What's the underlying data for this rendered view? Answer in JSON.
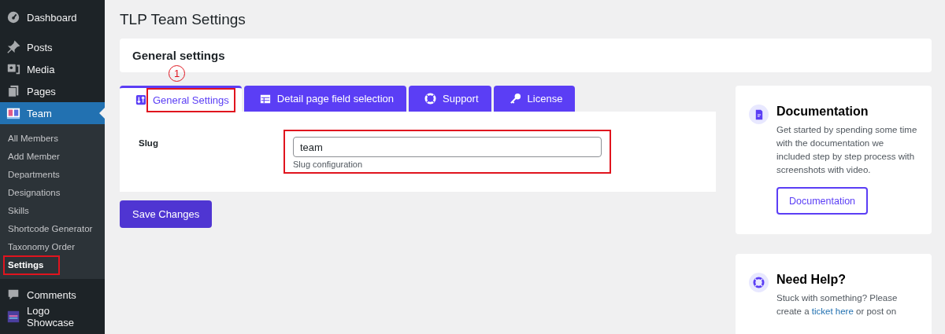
{
  "sidebar": {
    "items": [
      {
        "label": "Dashboard",
        "current": false
      },
      {
        "label": "Posts",
        "current": false
      },
      {
        "label": "Media",
        "current": false
      },
      {
        "label": "Pages",
        "current": false
      },
      {
        "label": "Team",
        "current": true,
        "children": [
          {
            "label": "All Members",
            "selected": false,
            "highlighted": false
          },
          {
            "label": "Add Member",
            "selected": false,
            "highlighted": false
          },
          {
            "label": "Departments",
            "selected": false,
            "highlighted": false
          },
          {
            "label": "Designations",
            "selected": false,
            "highlighted": false
          },
          {
            "label": "Skills",
            "selected": false,
            "highlighted": false
          },
          {
            "label": "Shortcode Generator",
            "selected": false,
            "highlighted": false
          },
          {
            "label": "Taxonomy Order",
            "selected": false,
            "highlighted": false
          },
          {
            "label": "Settings",
            "selected": true,
            "highlighted": true
          }
        ]
      },
      {
        "label": "Comments",
        "current": false
      },
      {
        "label": "Logo Showcase",
        "current": false
      }
    ]
  },
  "page_title": "TLP Team Settings",
  "header_card": {
    "title": "General settings"
  },
  "step_marker": "1",
  "tabs": [
    {
      "label": "General Settings",
      "selected": true,
      "highlighted": true
    },
    {
      "label": "Detail page field selection",
      "selected": false,
      "highlighted": false
    },
    {
      "label": "Support",
      "selected": false,
      "highlighted": false
    },
    {
      "label": "License",
      "selected": false,
      "highlighted": false
    }
  ],
  "fields": [
    {
      "label": "Slug",
      "value": "team",
      "description": "Slug configuration",
      "highlighted": true
    }
  ],
  "save_button": "Save Changes",
  "side_cards": [
    {
      "title": "Documentation",
      "text": "Get started by spending some time with the documentation we included step by step process with screenshots with video.",
      "button": "Documentation"
    },
    {
      "title": "Need Help?",
      "text_before": "Stuck with something? Please create a",
      "link": "ticket here",
      "text_after": "or post on"
    }
  ]
}
